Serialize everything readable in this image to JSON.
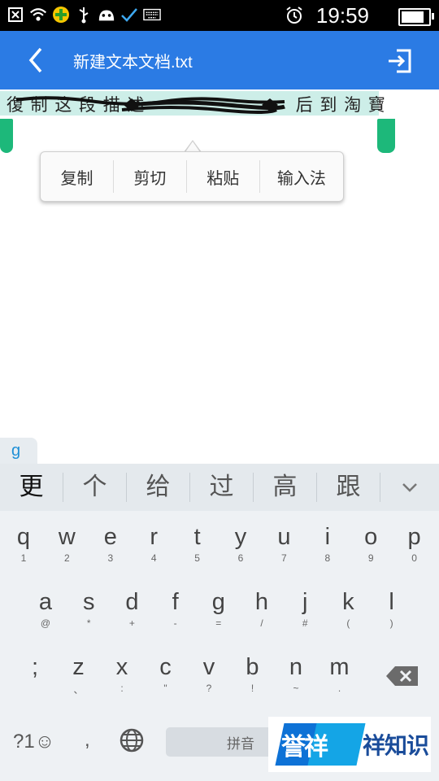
{
  "status_bar": {
    "icons": [
      "notification-x-icon",
      "wifi-icon",
      "app-360-icon",
      "usb-icon",
      "android-icon",
      "check-icon",
      "keyboard-icon"
    ],
    "time": "19:59",
    "battery_level": 0.9
  },
  "app_bar": {
    "title": "新建文本文档.txt",
    "back_icon": "back-arrow-icon",
    "exit_icon": "exit-icon"
  },
  "document": {
    "selected_text_visible": "復 制 这 段 描 述 ",
    "selected_text_tail": " 后 到 淘 寶"
  },
  "context_menu": {
    "items": [
      "复制",
      "剪切",
      "粘贴",
      "输入法"
    ]
  },
  "keyboard": {
    "composing": "g",
    "candidates": [
      "更",
      "个",
      "给",
      "过",
      "高",
      "跟"
    ],
    "row1": [
      {
        "k": "q",
        "s": "1"
      },
      {
        "k": "w",
        "s": "2"
      },
      {
        "k": "e",
        "s": "3"
      },
      {
        "k": "r",
        "s": "4"
      },
      {
        "k": "t",
        "s": "5"
      },
      {
        "k": "y",
        "s": "6"
      },
      {
        "k": "u",
        "s": "7"
      },
      {
        "k": "i",
        "s": "8"
      },
      {
        "k": "o",
        "s": "9"
      },
      {
        "k": "p",
        "s": "0"
      }
    ],
    "row2": [
      {
        "k": "a",
        "s": "@"
      },
      {
        "k": "s",
        "s": "*"
      },
      {
        "k": "d",
        "s": "+"
      },
      {
        "k": "f",
        "s": "-"
      },
      {
        "k": "g",
        "s": "="
      },
      {
        "k": "h",
        "s": "/"
      },
      {
        "k": "j",
        "s": "#"
      },
      {
        "k": "k",
        "s": "("
      },
      {
        "k": "l",
        "s": ")"
      }
    ],
    "row3": [
      {
        "k": ";",
        "s": ""
      },
      {
        "k": "z",
        "s": "、"
      },
      {
        "k": "x",
        "s": ":"
      },
      {
        "k": "c",
        "s": "\""
      },
      {
        "k": "v",
        "s": "?"
      },
      {
        "k": "b",
        "s": "!"
      },
      {
        "k": "n",
        "s": "~"
      },
      {
        "k": "m",
        "s": "."
      }
    ],
    "symbol_key": "?1",
    "comma_key": ",",
    "space_label": "拼音"
  },
  "watermark": {
    "text_a": "誉祥",
    "text_b": "祥知识"
  },
  "colors": {
    "app_bar": "#2b7be4",
    "selection": "#cdeee8",
    "handle": "#1db87a"
  }
}
